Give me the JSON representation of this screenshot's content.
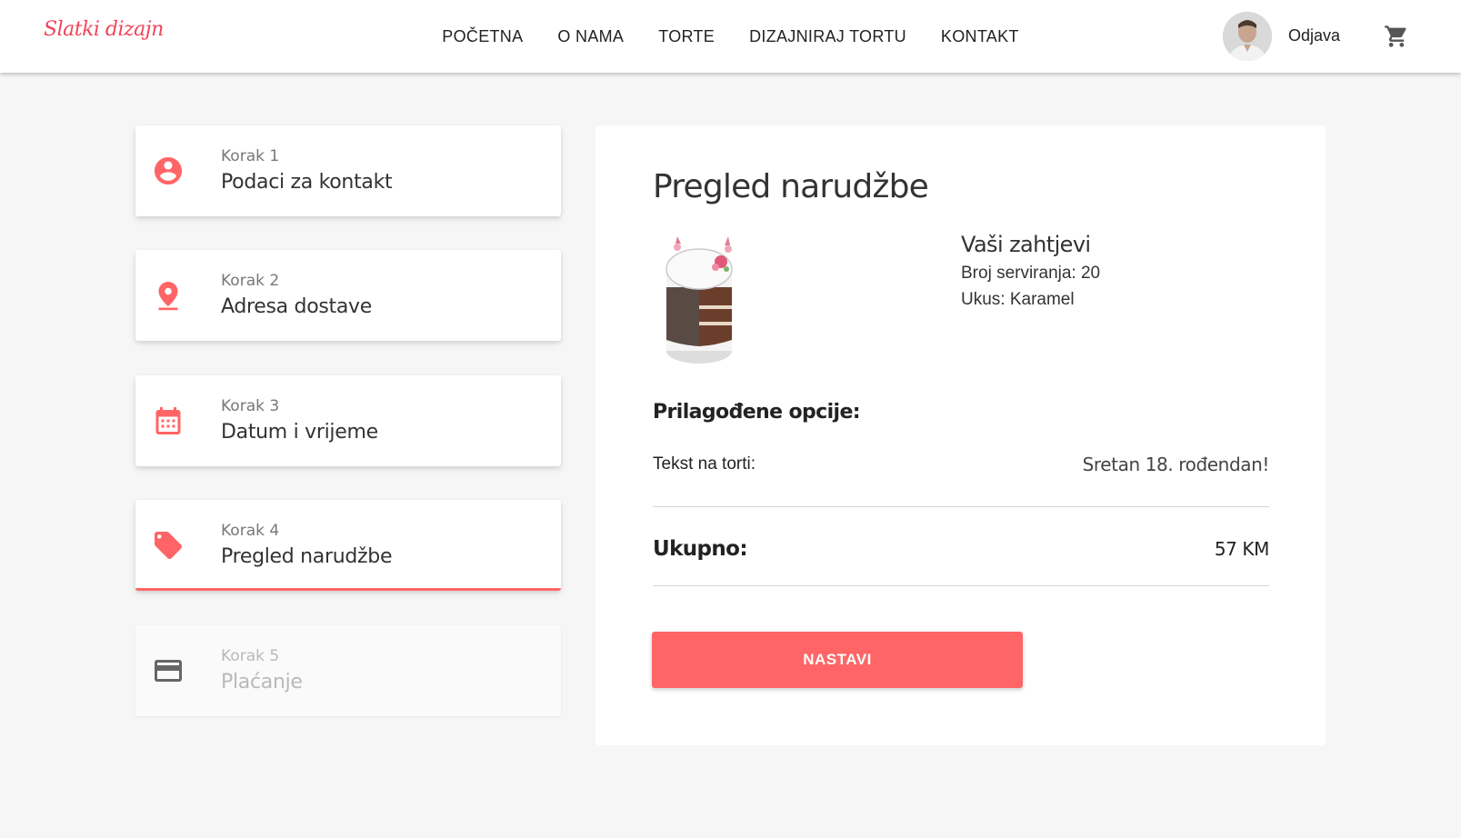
{
  "brand": {
    "logo_text": "Slatki dizajn",
    "accent_color": "#ff6566"
  },
  "nav": {
    "items": [
      "POČETNA",
      "O NAMA",
      "TORTE",
      "DIZAJNIRAJ TORTU",
      "KONTAKT"
    ],
    "user_icon": "user-avatar",
    "logout_label": "Odjava",
    "cart_icon": "shopping-cart-icon"
  },
  "steps": [
    {
      "kicker": "Korak 1",
      "title": "Podaci za kontakt",
      "icon": "account-circle-icon",
      "state": "done"
    },
    {
      "kicker": "Korak 2",
      "title": "Adresa dostave",
      "icon": "location-pin-icon",
      "state": "done"
    },
    {
      "kicker": "Korak 3",
      "title": "Datum i vrijeme",
      "icon": "calendar-icon",
      "state": "done"
    },
    {
      "kicker": "Korak 4",
      "title": "Pregled narudžbe",
      "icon": "tag-icon",
      "state": "active"
    },
    {
      "kicker": "Korak 5",
      "title": "Plaćanje",
      "icon": "credit-card-icon",
      "state": "disabled"
    }
  ],
  "review": {
    "title": "Pregled narudžbe",
    "requests_title": "Vaši zahtjevi",
    "servings": "Broj serviranja: 20",
    "flavor": "Ukus: Karamel",
    "custom_title": "Prilagođene opcije:",
    "cake_text_label": "Tekst na torti:",
    "cake_text_value": "Sretan 18. rođendan!",
    "total_label": "Ukupno:",
    "total_value": "57 KM",
    "continue_label": "NASTAVI"
  }
}
